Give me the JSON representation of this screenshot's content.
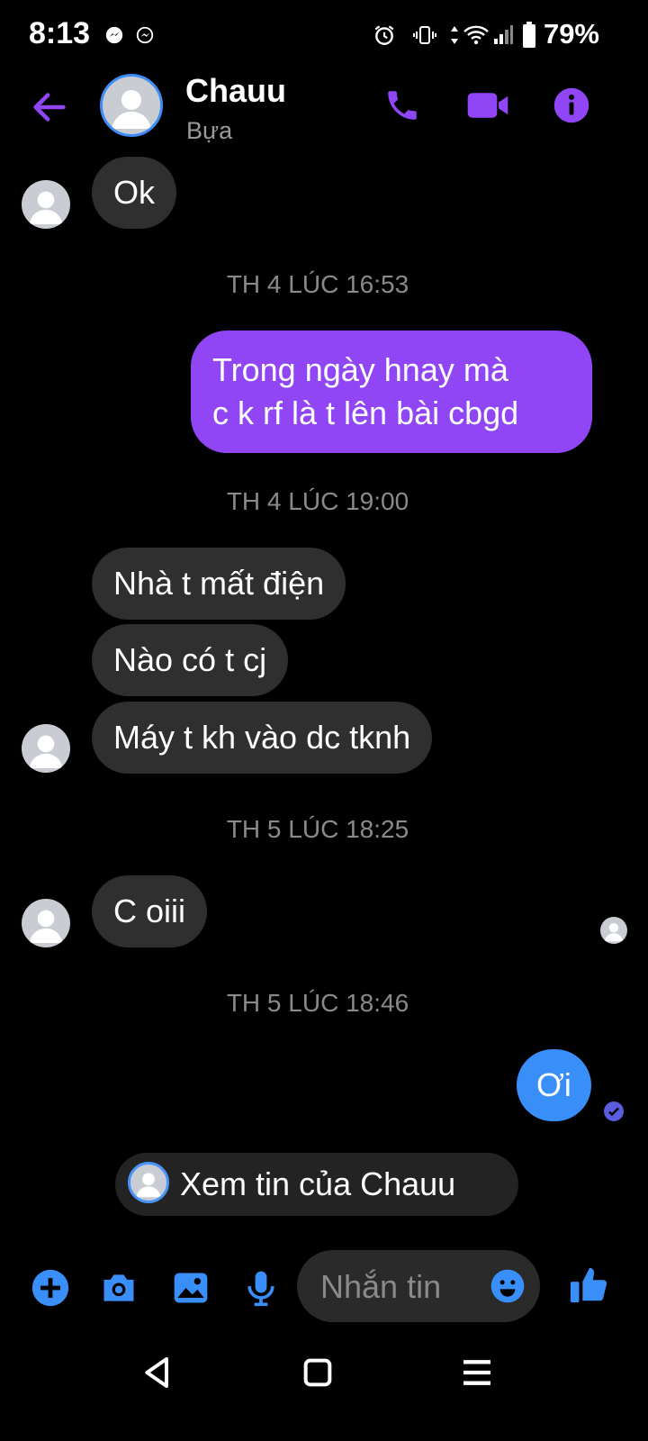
{
  "status_bar": {
    "time": "8:13",
    "battery": "79%",
    "icons": [
      "messenger-icon",
      "messenger-icon",
      "alarm-icon",
      "vibrate-icon",
      "data-icon",
      "wifi-icon",
      "signal-icon",
      "battery-icon"
    ]
  },
  "header": {
    "name": "Chauu",
    "subtitle": "Bựa",
    "icons": [
      "back-arrow-icon",
      "phone-icon",
      "video-icon",
      "info-icon"
    ]
  },
  "messages": {
    "m1": "Ok",
    "ts1": "TH 4 LÚC 16:53",
    "m2_line1": "Trong ngày hnay mà",
    "m2_line2": "c k rf là t lên bài cbgd",
    "ts2": "TH 4 LÚC 19:00",
    "m3": "Nhà t mất điện",
    "m4": "Nào có t cj",
    "m5": "Máy t kh vào dc tknh",
    "ts3": "TH 5 LÚC 18:25",
    "m6": "C oiii",
    "ts4": "TH 5 LÚC 18:46",
    "m7": "Ơi"
  },
  "story_pill": {
    "label": "Xem tin của Chauu"
  },
  "composer": {
    "placeholder": "Nhắn tin",
    "icons": [
      "plus-icon",
      "camera-icon",
      "gallery-icon",
      "mic-icon",
      "emoji-icon",
      "like-icon"
    ]
  },
  "colors": {
    "accent_purple": "#9146f5",
    "accent_blue": "#3a8ef7",
    "incoming_bubble": "#2f2f2f"
  }
}
